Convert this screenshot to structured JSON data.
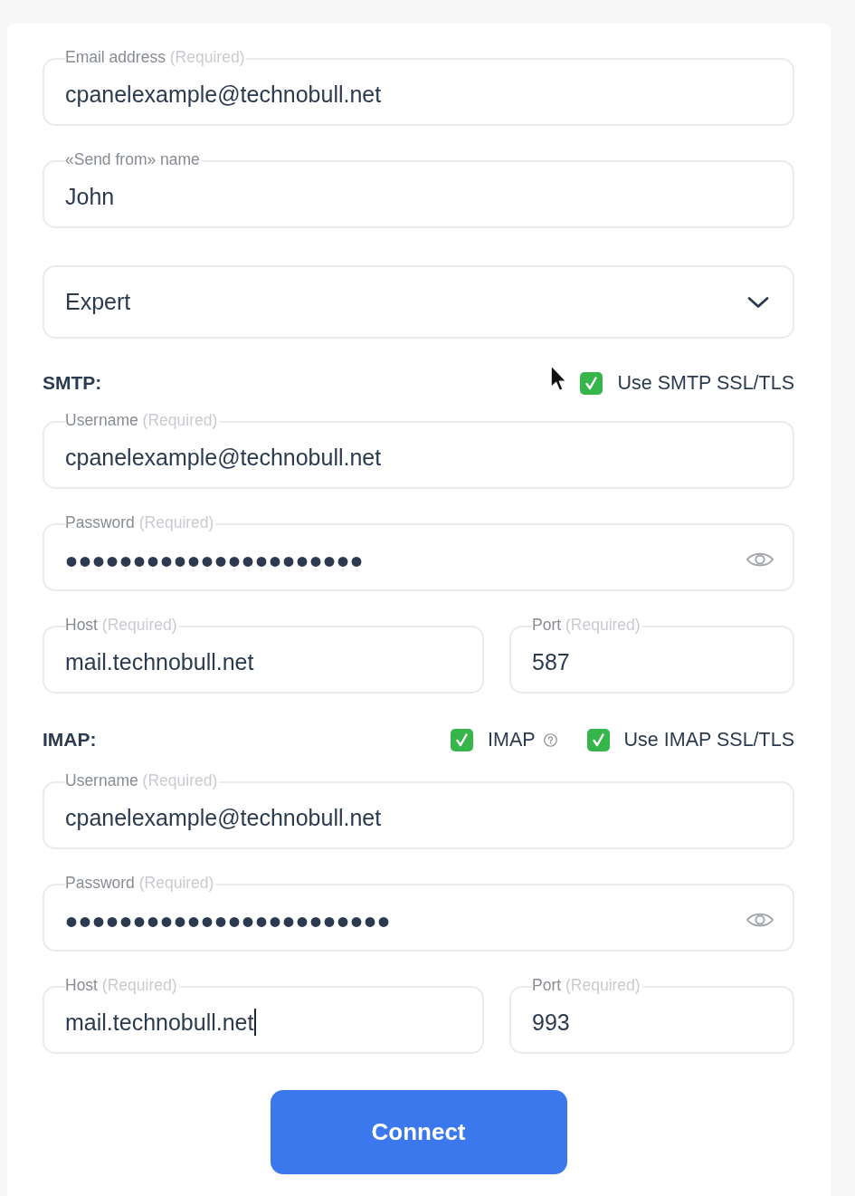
{
  "account_fields": [
    {
      "label": "Email address",
      "note": "(Required)",
      "value": "cpanelexample@technobull.net"
    },
    {
      "label": "«Send from» name",
      "value": "John"
    }
  ],
  "mode_select": {
    "value": "Expert"
  },
  "sections": [
    {
      "title": "SMTP:",
      "options": [
        {
          "label": "Use SMTP SSL/TLS",
          "checked": true,
          "help": false
        }
      ],
      "fields": [
        {
          "kind": "text",
          "label": "Username",
          "note": "(Required)",
          "value": "cpanelexample@technobull.net"
        },
        {
          "kind": "password",
          "label": "Password",
          "note": "(Required)",
          "value": "••••••••••••••••••••••"
        }
      ],
      "server_fields": [
        {
          "label": "Host",
          "note": "(Required)",
          "value": "mail.technobull.net",
          "focused": false
        },
        {
          "label": "Port",
          "note": "(Required)",
          "value": "587",
          "focused": false
        }
      ]
    },
    {
      "title": "IMAP:",
      "options": [
        {
          "label": "IMAP",
          "checked": true,
          "help": true
        },
        {
          "label": "Use IMAP SSL/TLS",
          "checked": true,
          "help": false
        }
      ],
      "fields": [
        {
          "kind": "text",
          "label": "Username",
          "note": "(Required)",
          "value": "cpanelexample@technobull.net"
        },
        {
          "kind": "password",
          "label": "Password",
          "note": "(Required)",
          "value": "••••••••••••••••••••••••"
        }
      ],
      "server_fields": [
        {
          "label": "Host",
          "note": "(Required)",
          "value": "mail.technobull.net",
          "focused": true
        },
        {
          "label": "Port",
          "note": "(Required)",
          "value": "993",
          "focused": false
        }
      ]
    }
  ],
  "connect_button": {
    "label": "Connect"
  }
}
